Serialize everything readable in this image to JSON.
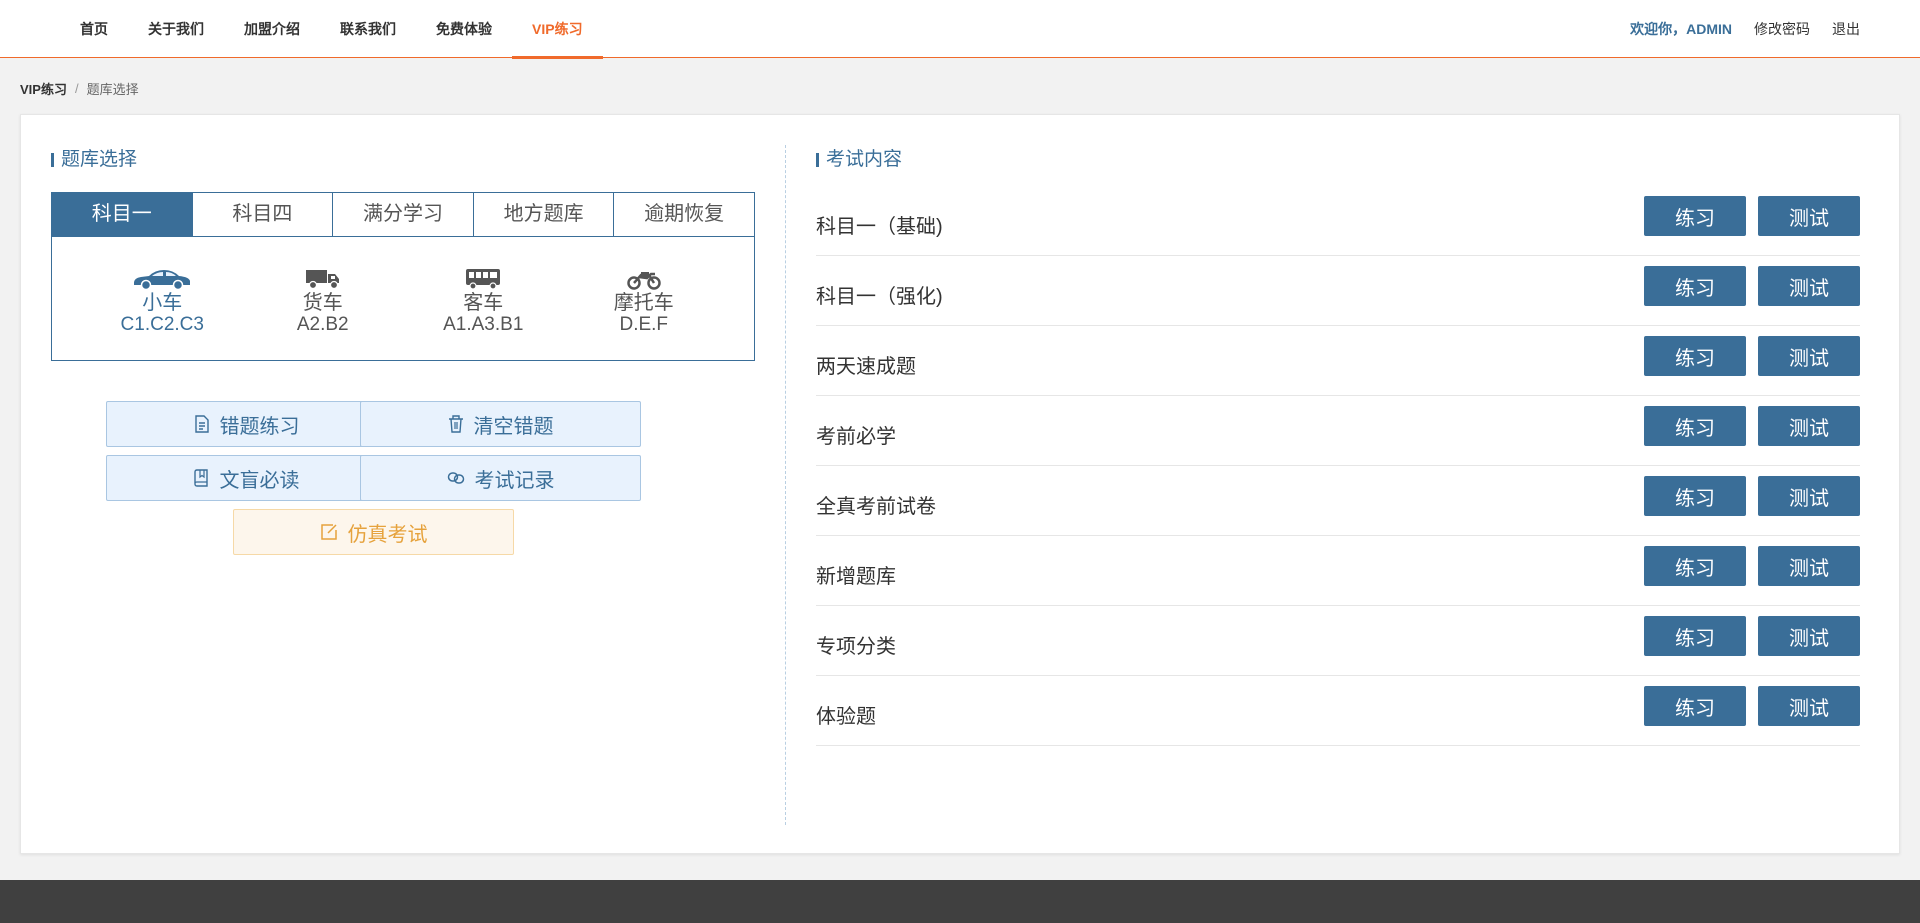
{
  "nav": {
    "items": [
      {
        "label": "首页"
      },
      {
        "label": "关于我们"
      },
      {
        "label": "加盟介绍"
      },
      {
        "label": "联系我们"
      },
      {
        "label": "免费体验"
      },
      {
        "label": "VIP练习",
        "active": true
      }
    ]
  },
  "user": {
    "welcome": "欢迎你，ADMIN",
    "change_password": "修改密码",
    "logout": "退出"
  },
  "breadcrumb": {
    "home": "VIP练习",
    "separator": "/",
    "current": "题库选择"
  },
  "left": {
    "title": "题库选择",
    "tabs": [
      {
        "label": "科目一",
        "active": true
      },
      {
        "label": "科目四"
      },
      {
        "label": "满分学习"
      },
      {
        "label": "地方题库"
      },
      {
        "label": "逾期恢复"
      }
    ],
    "vehicles": [
      {
        "name": "小车",
        "code": "C1.C2.C3",
        "icon": "car-icon",
        "active": true
      },
      {
        "name": "货车",
        "code": "A2.B2",
        "icon": "truck-icon"
      },
      {
        "name": "客车",
        "code": "A1.A3.B1",
        "icon": "bus-icon"
      },
      {
        "name": "摩托车",
        "code": "D.E.F",
        "icon": "motorcycle-icon"
      }
    ],
    "actions": {
      "wrong_practice": "错题练习",
      "clear_wrong": "清空错题",
      "must_read": "文盲必读",
      "exam_records": "考试记录",
      "mock_exam": "仿真考试"
    }
  },
  "right": {
    "title": "考试内容",
    "practice_label": "练习",
    "test_label": "测试",
    "items": [
      {
        "name": "科目一（基础)"
      },
      {
        "name": "科目一（强化)"
      },
      {
        "name": "两天速成题"
      },
      {
        "name": "考前必学"
      },
      {
        "name": "全真考前试卷"
      },
      {
        "name": "新增题库"
      },
      {
        "name": "专项分类"
      },
      {
        "name": "体验题"
      }
    ]
  },
  "colors": {
    "primary": "#3a6e98",
    "accent": "#f06a2b",
    "warning": "#e6a23c",
    "footer": "#404040"
  }
}
